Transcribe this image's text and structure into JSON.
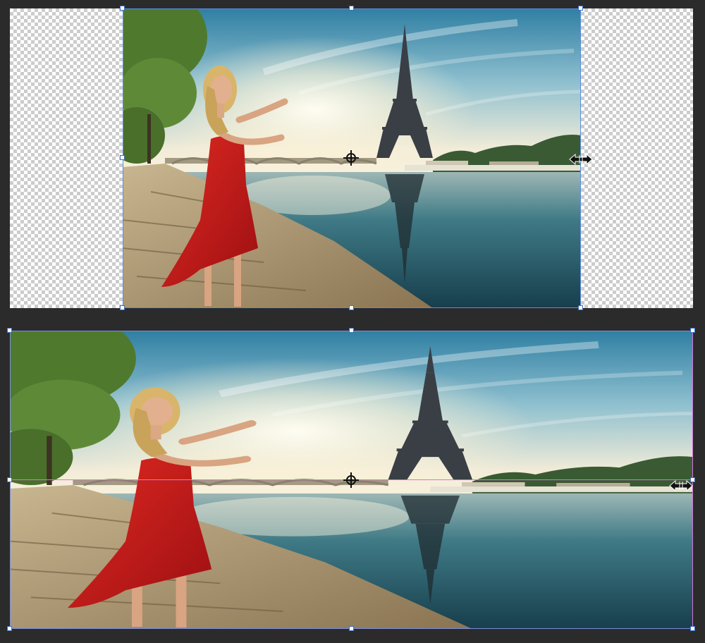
{
  "workspace": {
    "background": "#2b2b2b",
    "transparency_pattern": "checkerboard"
  },
  "layers": [
    {
      "name": "original-layer",
      "state": "unscaled",
      "selected": true
    },
    {
      "name": "stretched-layer",
      "state": "stretched horizontally",
      "selected": true
    }
  ],
  "icons": {
    "anchor": "crosshair-icon",
    "cursor": "horizontal-resize-icon",
    "handles": "transform-handle-icon"
  },
  "colors": {
    "selection": "#5b8fe0",
    "smart_guide": "#d477d8",
    "dress": "#c8191b",
    "sky_top": "#2f7fa3",
    "water": "#1f4f5e"
  }
}
